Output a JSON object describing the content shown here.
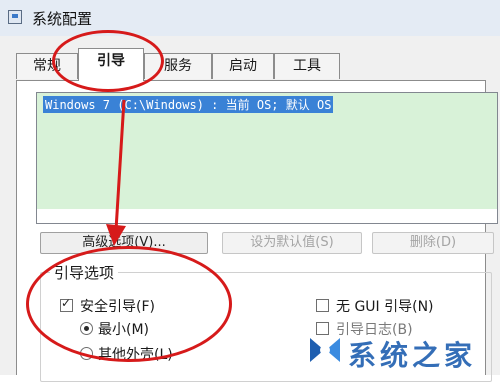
{
  "window": {
    "title": "系统配置"
  },
  "tabs": [
    {
      "label": "常规"
    },
    {
      "label": "引导"
    },
    {
      "label": "服务"
    },
    {
      "label": "启动"
    },
    {
      "label": "工具"
    }
  ],
  "os_list": {
    "entries": [
      {
        "text": "Windows 7 (C:\\Windows) : 当前 OS; 默认 OS"
      }
    ]
  },
  "buttons": {
    "advanced": "高级选项(V)...",
    "set_default": "设为默认值(S)",
    "delete": "删除(D)"
  },
  "boot_options": {
    "title": "引导选项",
    "safe_boot": {
      "label": "安全引导(F)",
      "checked": true
    },
    "minimal": {
      "label": "最小(M)",
      "selected": true
    },
    "alternate_shell": {
      "label": "其他外壳(L)",
      "selected": false
    },
    "no_gui": {
      "label": "无 GUI 引导(N)",
      "checked": false
    },
    "boot_log": {
      "label": "引导日志(B)",
      "checked": false
    }
  },
  "watermark": {
    "text": "系统之家"
  },
  "colors": {
    "annotation": "#d61a1a",
    "selection": "#3a82d6",
    "list_bg": "#d8f2d8"
  }
}
